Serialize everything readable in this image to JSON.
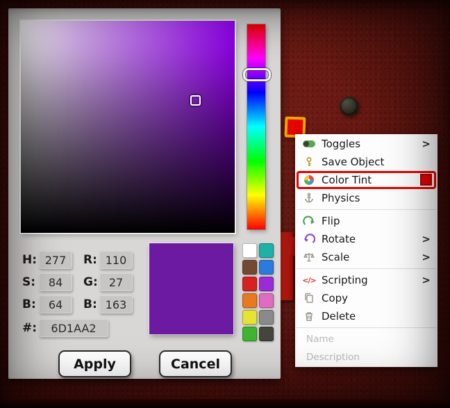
{
  "picker": {
    "fields": {
      "h": {
        "label": "H:",
        "value": "277"
      },
      "s": {
        "label": "S:",
        "value": "84"
      },
      "b": {
        "label": "B:",
        "value": "64"
      },
      "r": {
        "label": "R:",
        "value": "110"
      },
      "g": {
        "label": "G:",
        "value": "27"
      },
      "b2": {
        "label": "B:",
        "value": "163"
      },
      "hex": {
        "label": "#:",
        "value": "6D1AA2"
      }
    },
    "preview_color": "#6D1AA2",
    "hue_pure_color": "#9D00FF",
    "apply_label": "Apply",
    "cancel_label": "Cancel",
    "swatches": [
      "#FFFFFF",
      "#1FB0A8",
      "#744932",
      "#2B7BDD",
      "#D52221",
      "#9B2BD6",
      "#E8791E",
      "#E06CC2",
      "#E6E337",
      "#8A8A8A",
      "#3FB52F",
      "#45453E"
    ]
  },
  "menu": {
    "arrow_glyph": ">",
    "scripting_glyph": "</>",
    "items": [
      {
        "label": "Toggles",
        "icon": "toggle-icon",
        "submenu": true
      },
      {
        "label": "Save Object",
        "icon": "key-icon"
      },
      {
        "label": "Color Tint",
        "icon": "palette-icon",
        "highlighted": true,
        "swatch": "#E60000"
      },
      {
        "label": "Physics",
        "icon": "anchor-icon"
      },
      {
        "label": "Flip",
        "icon": "flip-icon"
      },
      {
        "label": "Rotate",
        "icon": "rotate-icon",
        "submenu": true
      },
      {
        "label": "Scale",
        "icon": "scale-icon",
        "submenu": true
      },
      {
        "label": "Scripting",
        "icon": "scripting-icon",
        "submenu": true
      },
      {
        "label": "Copy",
        "icon": "copy-icon"
      },
      {
        "label": "Delete",
        "icon": "trash-icon"
      },
      {
        "label": "Name",
        "disabled": true
      },
      {
        "label": "Description",
        "disabled": true
      }
    ]
  }
}
